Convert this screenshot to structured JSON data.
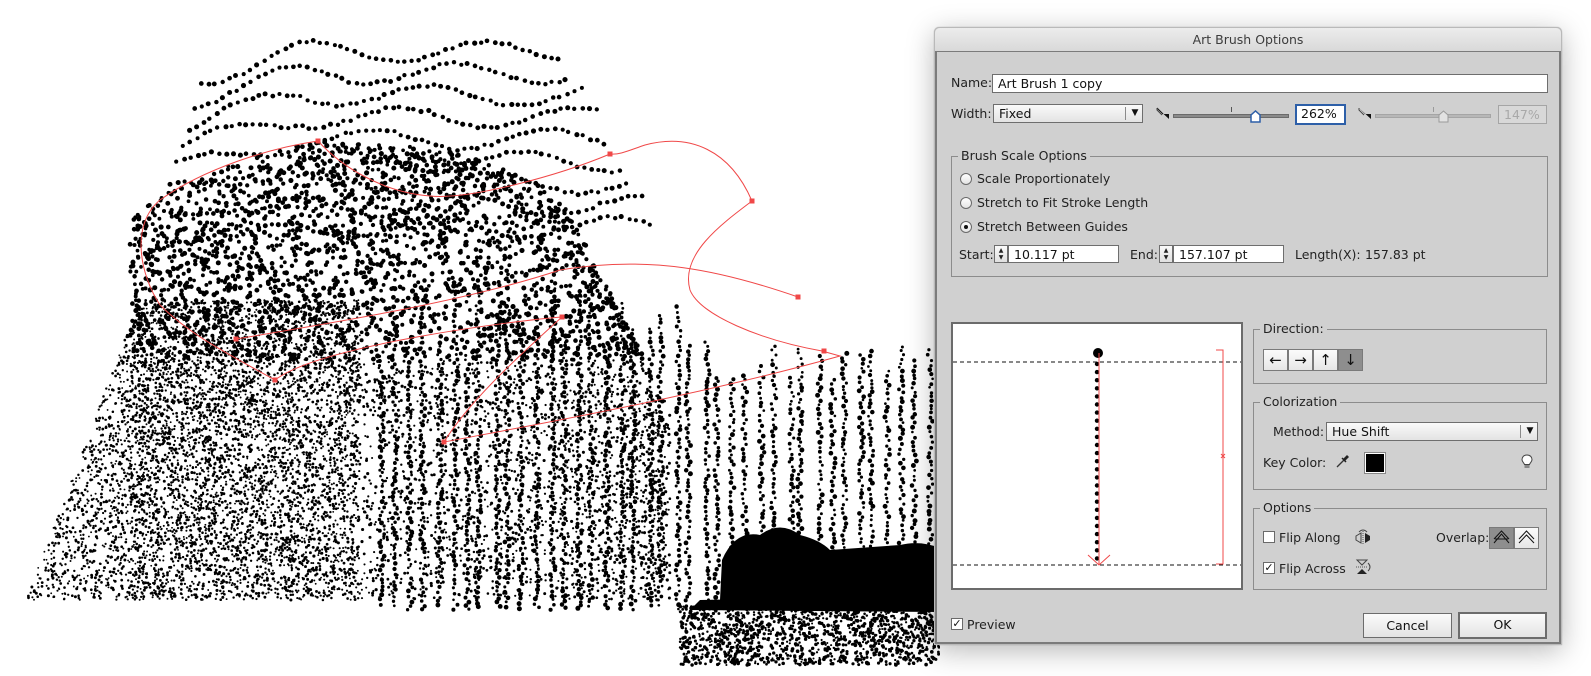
{
  "canvas": {
    "description": "Dotted point-cloud artwork with a selected red brush path",
    "path_color": "#f04848",
    "art_color": "#000000"
  },
  "dialog": {
    "title": "Art Brush Options",
    "name_label": "Name:",
    "name_value": "Art Brush 1 copy",
    "width_label": "Width:",
    "width_select_value": "Fixed",
    "width_slider_value": "262%",
    "width_slider_fraction": 0.71,
    "width_secondary_value": "147%",
    "width_secondary_fraction": 0.59,
    "width_secondary_disabled": true,
    "brush_scale": {
      "title": "Brush Scale Options",
      "options": [
        {
          "label": "Scale Proportionately",
          "selected": false
        },
        {
          "label": "Stretch to Fit Stroke Length",
          "selected": false
        },
        {
          "label": "Stretch Between Guides",
          "selected": true
        }
      ],
      "start_label": "Start:",
      "start_value": "10.117 pt",
      "end_label": "End:",
      "end_value": "157.107 pt",
      "length_label": "Length(X):",
      "length_value": "157.83 pt"
    },
    "direction": {
      "title": "Direction:",
      "buttons": [
        {
          "icon": "arrow-left-icon",
          "glyph": "←",
          "active": false
        },
        {
          "icon": "arrow-right-icon",
          "glyph": "→",
          "active": false
        },
        {
          "icon": "arrow-up-icon",
          "glyph": "↑",
          "active": false
        },
        {
          "icon": "arrow-down-icon",
          "glyph": "↓",
          "active": true
        }
      ]
    },
    "colorization": {
      "title": "Colorization",
      "method_label": "Method:",
      "method_value": "Hue Shift",
      "key_color_label": "Key Color:",
      "key_color": "#000000"
    },
    "options": {
      "title": "Options",
      "flip_along_label": "Flip Along",
      "flip_along_checked": false,
      "flip_across_label": "Flip Across",
      "flip_across_checked": true,
      "overlap_label": "Overlap:",
      "overlap_active_index": 0
    },
    "preview_label": "Preview",
    "preview_checked": true,
    "cancel_label": "Cancel",
    "ok_label": "OK",
    "check_glyph": "✓",
    "dropdown_glyph": "▼"
  }
}
